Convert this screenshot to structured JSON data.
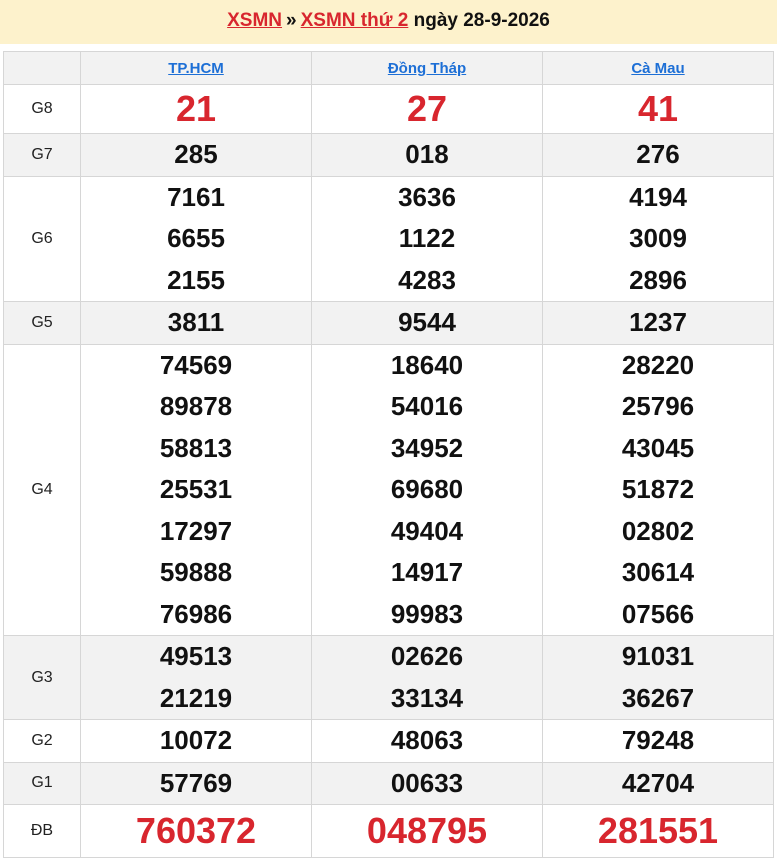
{
  "header": {
    "link1": "XSMN",
    "separator": "»",
    "link2": "XSMN thứ 2",
    "date_text": "ngày 28-9-2026"
  },
  "colors": {
    "accent_red": "#d8262e",
    "link_blue": "#1d6fd6",
    "header_bg": "#fdf2cc",
    "alt_row_bg": "#f2f2f2"
  },
  "provinces": [
    "TP.HCM",
    "Đồng Tháp",
    "Cà Mau"
  ],
  "rows": [
    {
      "label": "G8",
      "style": "big-red",
      "alt": false,
      "values": [
        [
          "21"
        ],
        [
          "27"
        ],
        [
          "41"
        ]
      ]
    },
    {
      "label": "G7",
      "style": "normal",
      "alt": true,
      "values": [
        [
          "285"
        ],
        [
          "018"
        ],
        [
          "276"
        ]
      ]
    },
    {
      "label": "G6",
      "style": "normal",
      "alt": false,
      "values": [
        [
          "7161",
          "6655",
          "2155"
        ],
        [
          "3636",
          "1122",
          "4283"
        ],
        [
          "4194",
          "3009",
          "2896"
        ]
      ]
    },
    {
      "label": "G5",
      "style": "normal",
      "alt": true,
      "values": [
        [
          "3811"
        ],
        [
          "9544"
        ],
        [
          "1237"
        ]
      ]
    },
    {
      "label": "G4",
      "style": "normal",
      "alt": false,
      "values": [
        [
          "74569",
          "89878",
          "58813",
          "25531",
          "17297",
          "59888",
          "76986"
        ],
        [
          "18640",
          "54016",
          "34952",
          "69680",
          "49404",
          "14917",
          "99983"
        ],
        [
          "28220",
          "25796",
          "43045",
          "51872",
          "02802",
          "30614",
          "07566"
        ]
      ]
    },
    {
      "label": "G3",
      "style": "normal",
      "alt": true,
      "values": [
        [
          "49513",
          "21219"
        ],
        [
          "02626",
          "33134"
        ],
        [
          "91031",
          "36267"
        ]
      ]
    },
    {
      "label": "G2",
      "style": "normal",
      "alt": false,
      "values": [
        [
          "10072"
        ],
        [
          "48063"
        ],
        [
          "79248"
        ]
      ]
    },
    {
      "label": "G1",
      "style": "normal",
      "alt": true,
      "values": [
        [
          "57769"
        ],
        [
          "00633"
        ],
        [
          "42704"
        ]
      ]
    },
    {
      "label": "ĐB",
      "style": "db-red",
      "alt": false,
      "values": [
        [
          "760372"
        ],
        [
          "048795"
        ],
        [
          "281551"
        ]
      ]
    }
  ]
}
